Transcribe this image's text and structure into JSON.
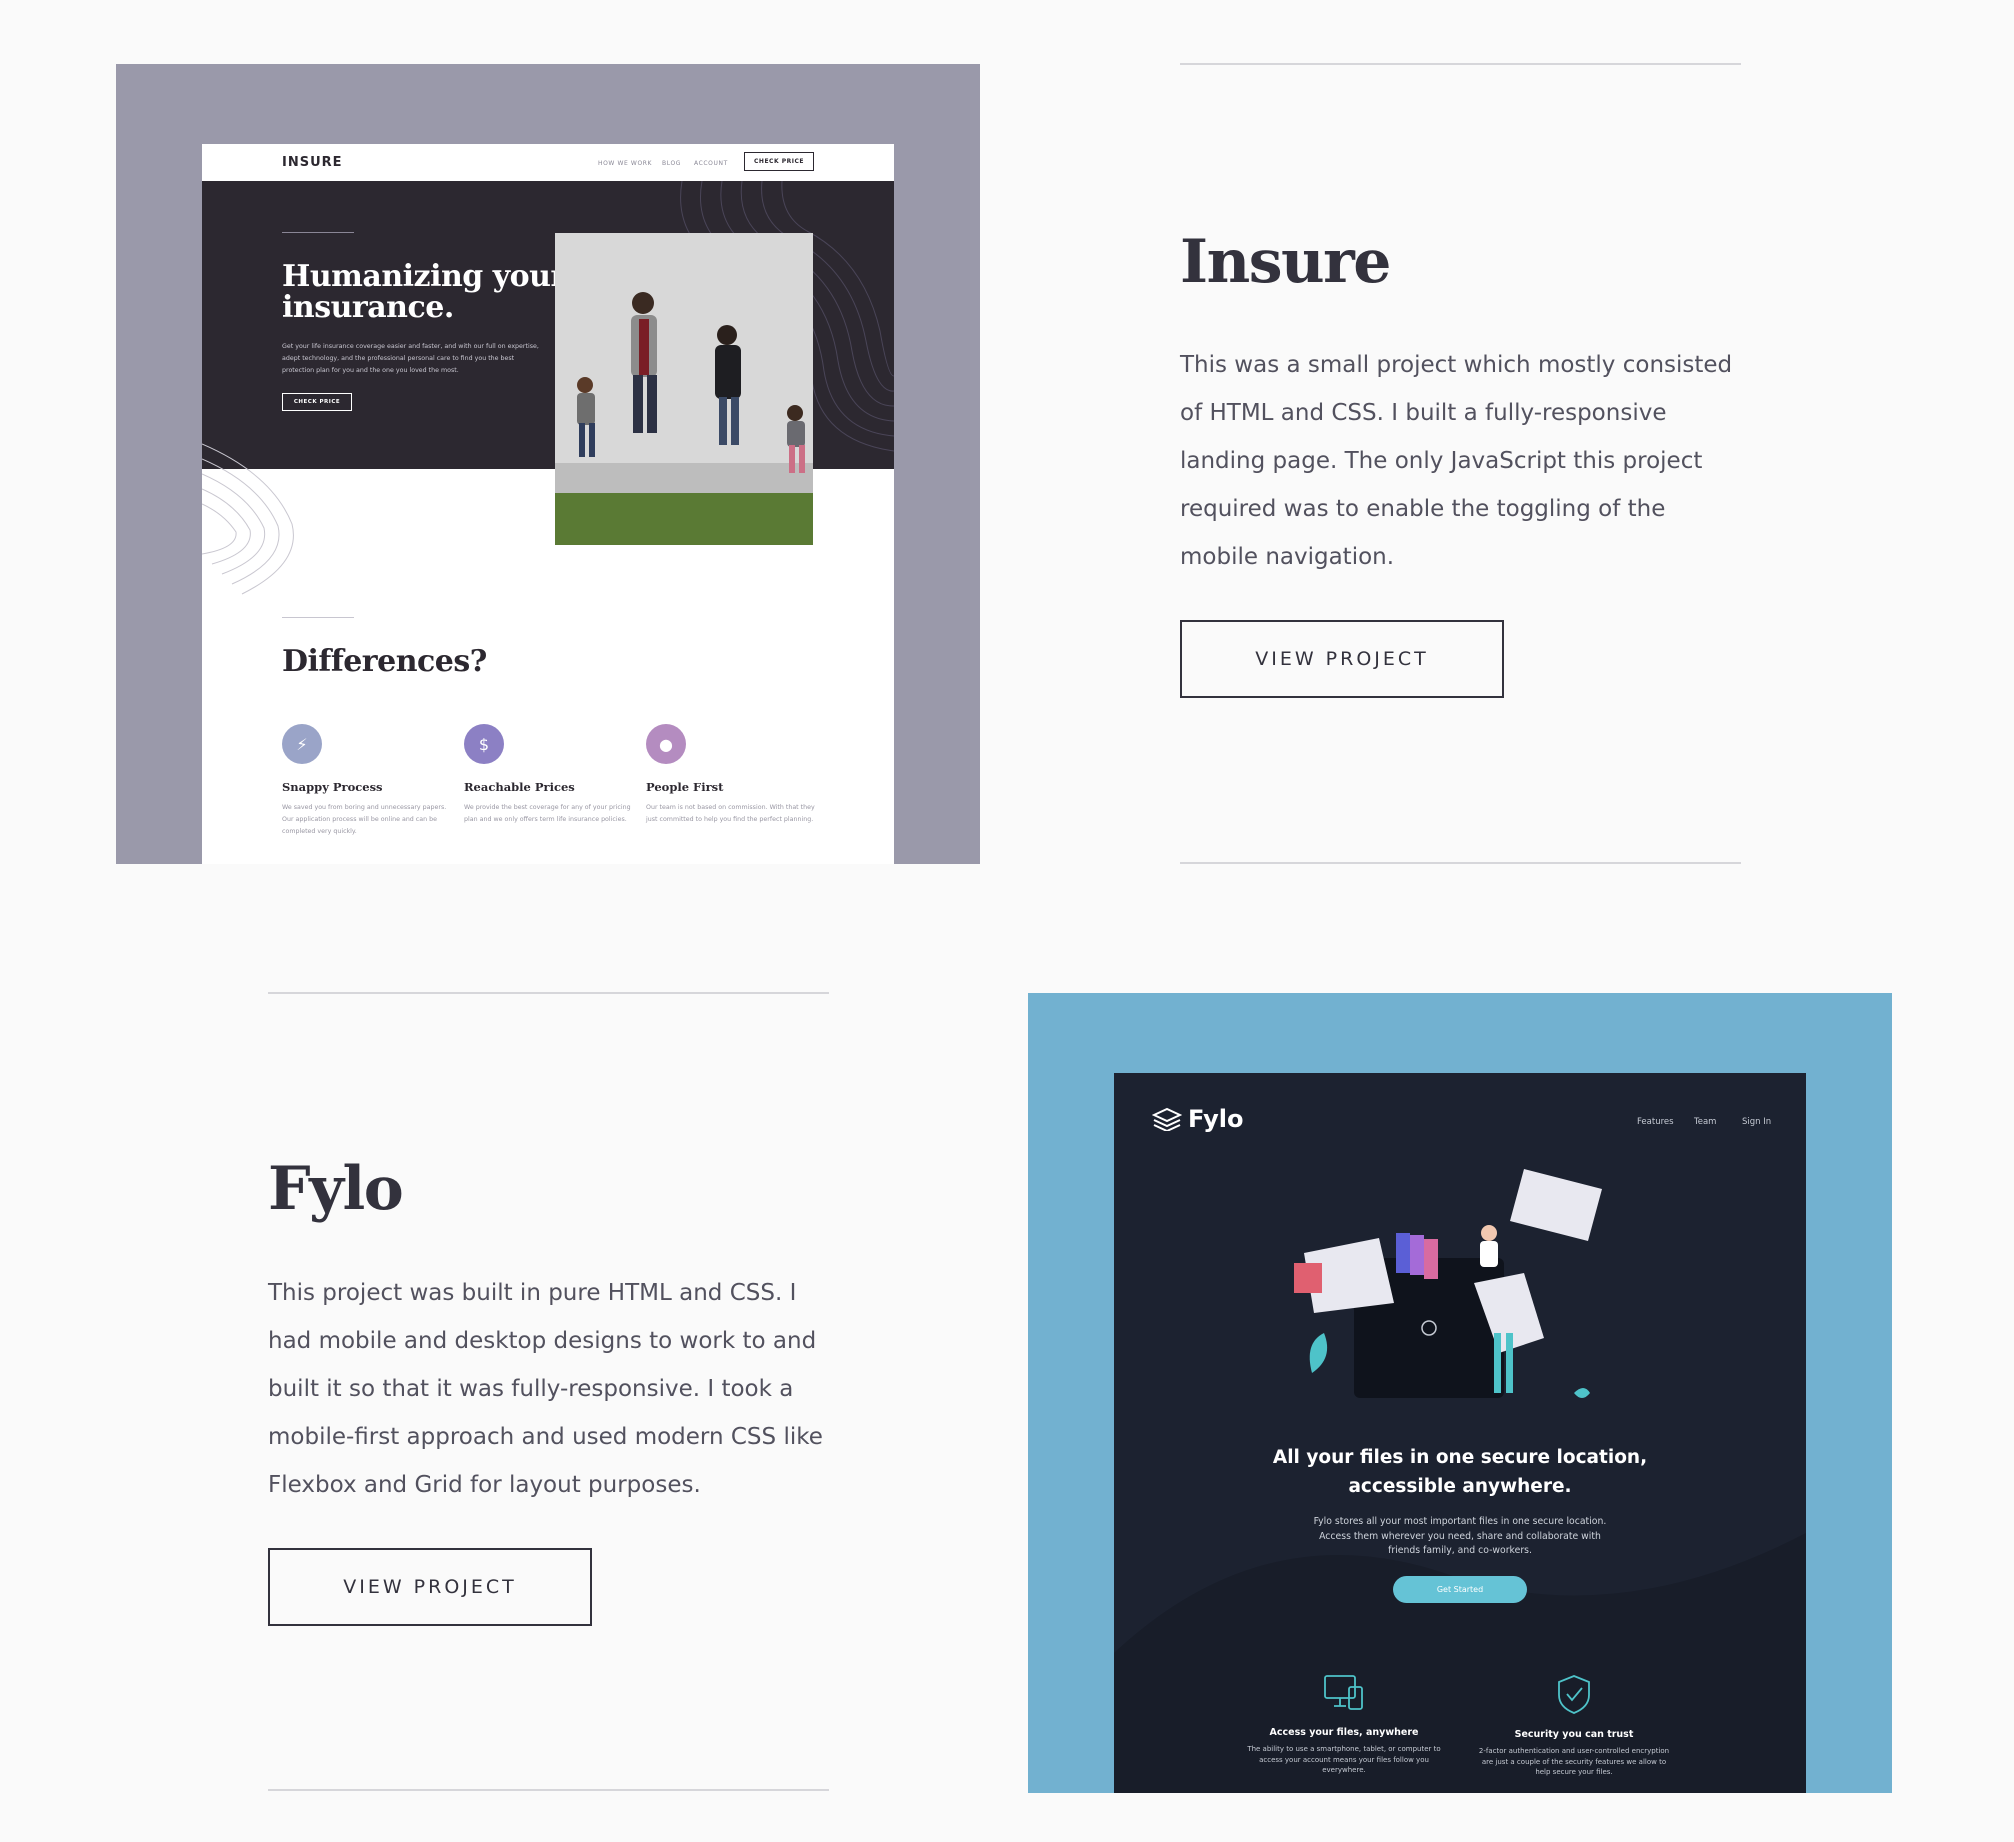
{
  "projects": [
    {
      "title": "Insure",
      "description": "This was a small project which mostly consisted of HTML and CSS. I built a fully-responsive landing page. The only JavaScript this project required was to enable the toggling of the mobile navigation.",
      "button": "VIEW PROJECT",
      "preview": {
        "frame_color": "#9a99aa",
        "logo": "INSURE",
        "nav": [
          "HOW WE WORK",
          "BLOG",
          "ACCOUNT"
        ],
        "nav_button": "CHECK PRICE",
        "hero_title": "Humanizing your insurance.",
        "hero_text": "Get your life insurance coverage easier and faster, and with our full on expertise, adept technology, and the professional personal care to find you the best protection plan for you and the one you loved the most.",
        "hero_button": "CHECK PRICE",
        "section_title": "Differences?",
        "features": [
          {
            "icon": "lightning-icon",
            "color": "#9aa4c8",
            "title": "Snappy Process",
            "text": "We saved you from boring and unnecessary papers. Our application process will be online and can be completed very quickly."
          },
          {
            "icon": "dollar-icon",
            "color": "#8c80c4",
            "title": "Reachable Prices",
            "text": "We provide the best coverage for any of your pricing plan and we only offers term life insurance policies."
          },
          {
            "icon": "person-icon",
            "color": "#b48cc0",
            "title": "People First",
            "text": "Our team is not based on commission. With that they just committed to help you find the perfect planning."
          }
        ]
      }
    },
    {
      "title": "Fylo",
      "description": "This project was built in pure HTML and CSS. I had mobile and desktop designs to work to and built it so that it was fully-responsive. I took a mobile-first approach and used modern CSS like Flexbox and Grid for layout purposes.",
      "button": "VIEW PROJECT",
      "preview": {
        "frame_color": "#72b1d0",
        "logo": "Fylo",
        "nav": [
          "Features",
          "Team",
          "Sign In"
        ],
        "hero_title": "All your files in one secure location, accessible anywhere.",
        "hero_text": "Fylo stores all your most important files in one secure location. Access them wherever you need, share and collaborate with friends family, and co-workers.",
        "hero_button": "Get Started",
        "features": [
          {
            "icon": "devices-icon",
            "title": "Access your files, anywhere",
            "text": "The ability to use a smartphone, tablet, or computer to access your account means your files follow you everywhere."
          },
          {
            "icon": "shield-icon",
            "title": "Security you can trust",
            "text": "2-factor authentication and user-controlled encryption are just a couple of the security features we allow to help secure your files."
          }
        ]
      }
    }
  ]
}
